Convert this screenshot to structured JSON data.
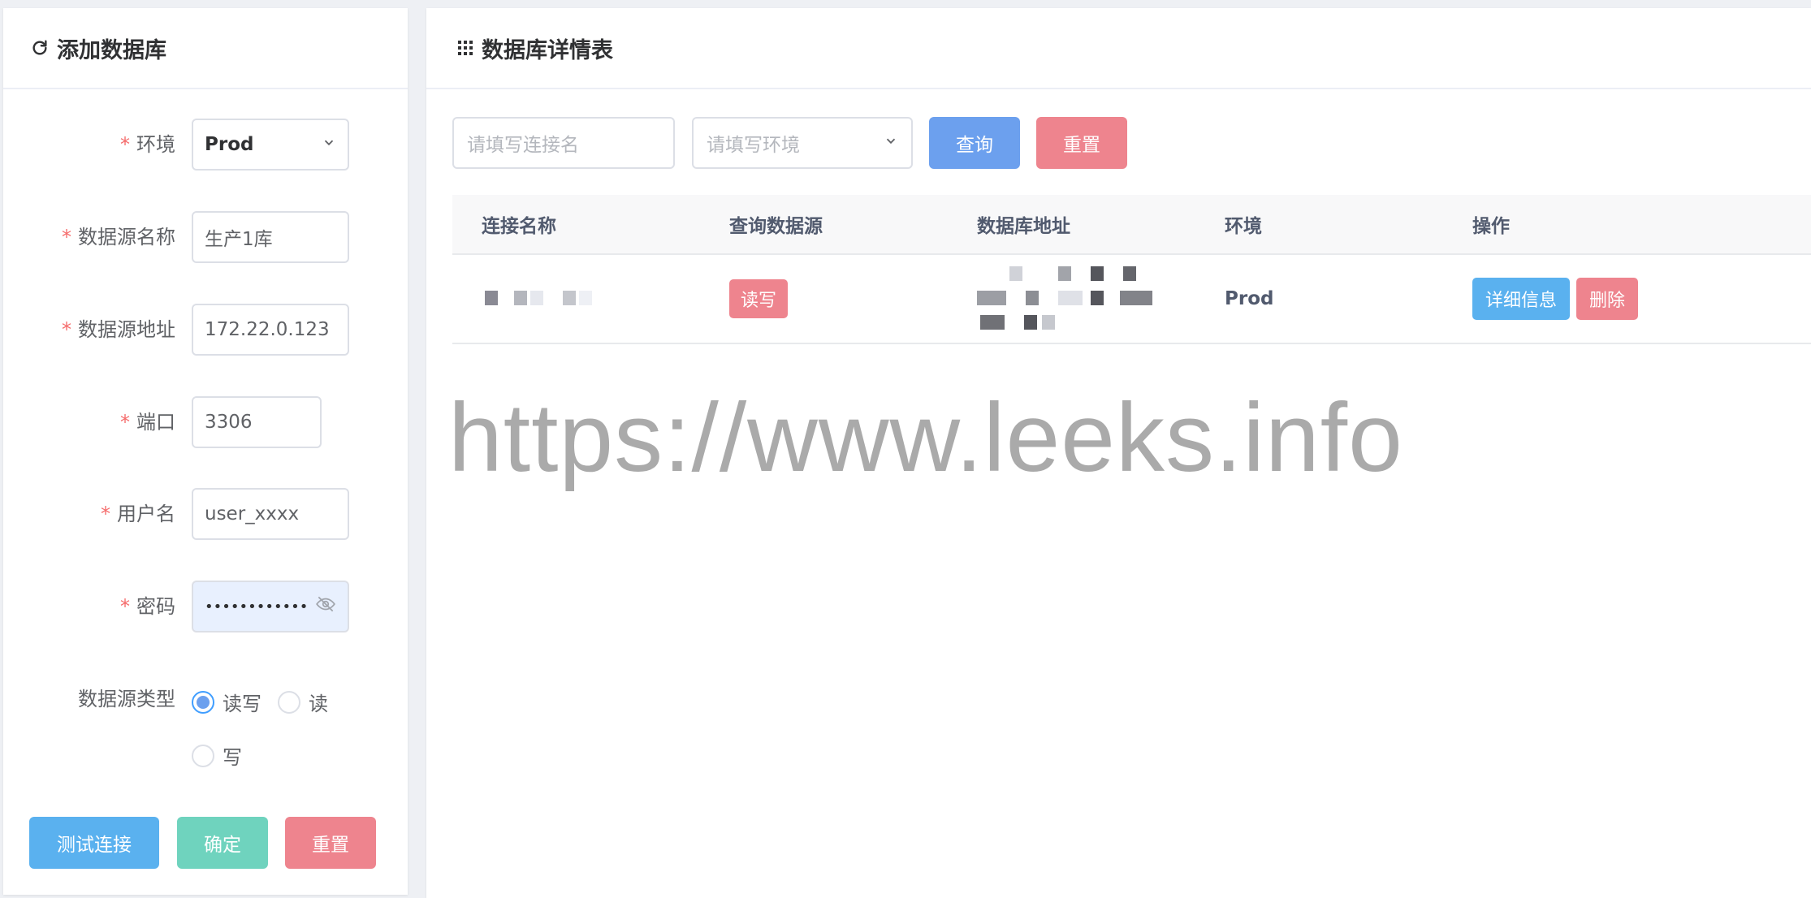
{
  "left_panel": {
    "title": "添加数据库",
    "form": {
      "env": {
        "label": "环境",
        "required_mark": "*",
        "value": "Prod"
      },
      "name": {
        "label": "数据源名称",
        "required_mark": "*",
        "value": "生产1库"
      },
      "address": {
        "label": "数据源地址",
        "required_mark": "*",
        "value": "172.22.0.123"
      },
      "port": {
        "label": "端口",
        "required_mark": "*",
        "value": "3306"
      },
      "username": {
        "label": "用户名",
        "required_mark": "*",
        "value": "user_xxxx"
      },
      "password": {
        "label": "密码",
        "required_mark": "*",
        "value": "••••••••••••"
      },
      "type": {
        "label": "数据源类型",
        "options": [
          "读写",
          "读",
          "写"
        ],
        "selected": "读写"
      }
    },
    "buttons": {
      "test": "测试连接",
      "confirm": "确定",
      "reset": "重置"
    }
  },
  "right_panel": {
    "title": "数据库详情表",
    "filters": {
      "name_placeholder": "请填写连接名",
      "env_placeholder": "请填写环境",
      "query": "查询",
      "reset": "重置"
    },
    "table": {
      "columns": [
        "连接名称",
        "查询数据源",
        "数据库地址",
        "环境",
        "操作"
      ],
      "rows": [
        {
          "source_tag": "读写",
          "env": "Prod",
          "detail": "详细信息",
          "delete": "删除"
        }
      ]
    }
  },
  "watermark": "https://www.leeks.info",
  "colors": {
    "primary": "#5ab1ef",
    "query_blue": "#6ca0ee",
    "success": "#6fd3be",
    "danger": "#ee848e",
    "required": "#f56c6c"
  }
}
